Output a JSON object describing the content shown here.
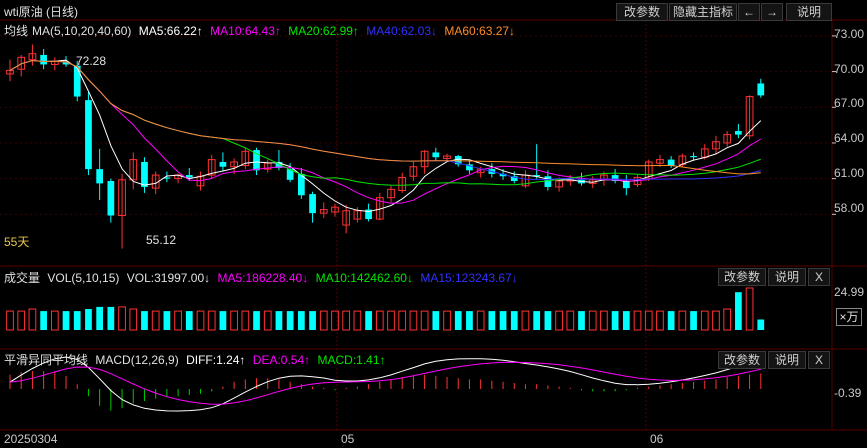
{
  "title": "wti原油 (日线)",
  "toolbar": {
    "edit_params": "改参数",
    "hide_indicators": "隐藏主指标",
    "left_arrow": "←",
    "right_arrow": "→",
    "help": "说明"
  },
  "main_indicator": {
    "name": "均线",
    "params": "MA(5,10,20,40,60)",
    "ma5": "MA5:66.22↑",
    "ma10": "MA10:64.43↑",
    "ma20": "MA20:62.99↑",
    "ma40": "MA40:62.03↓",
    "ma60": "MA60:63.27↓",
    "high_label": "72.28",
    "low_label": "55.12",
    "period_label": "55天",
    "y_ticks": [
      "73.00",
      "70.00",
      "67.00",
      "64.00",
      "61.00",
      "58.00"
    ]
  },
  "volume_panel": {
    "name": "成交量",
    "params": "VOL(5,10,15)",
    "vol": "VOL:31997.00↓",
    "ma5": "MA5:186228.40↓",
    "ma10": "MA10:142462.60↓",
    "ma15": "MA15:123243.67↓",
    "edit_params": "改参数",
    "help": "说明",
    "close": "X",
    "y_tick": "24.99",
    "unit": "×万"
  },
  "macd_panel": {
    "name": "平滑异同平均线",
    "params": "MACD(12,26,9)",
    "diff": "DIFF:1.24↑",
    "dea": "DEA:0.54↑",
    "macd": "MACD:1.41↑",
    "edit_params": "改参数",
    "help": "说明",
    "close": "X",
    "y_tick": "-0.39"
  },
  "x_axis": {
    "start": "20250304",
    "month5": "05",
    "month6": "06"
  },
  "colors": {
    "up": "#ff3232",
    "down": "#00ffff",
    "ma5": "#ffffff",
    "ma10": "#ff00ff",
    "ma20": "#00e600",
    "ma40": "#3030ff",
    "ma60": "#ff8c28",
    "macd_down": "#00c800",
    "grid": "#5a0000"
  },
  "chart_data": {
    "type": "candlestick",
    "y_range": [
      55.0,
      74.0
    ],
    "candles": [
      {
        "o": 69.8,
        "h": 71.0,
        "l": 69.2,
        "c": 70.1
      },
      {
        "o": 70.2,
        "h": 71.4,
        "l": 69.6,
        "c": 71.2
      },
      {
        "o": 71.0,
        "h": 72.28,
        "l": 70.5,
        "c": 71.5
      },
      {
        "o": 71.4,
        "h": 71.9,
        "l": 70.2,
        "c": 70.6
      },
      {
        "o": 70.6,
        "h": 71.2,
        "l": 70.1,
        "c": 70.9
      },
      {
        "o": 70.8,
        "h": 71.3,
        "l": 70.4,
        "c": 70.6
      },
      {
        "o": 70.5,
        "h": 70.9,
        "l": 67.5,
        "c": 67.9
      },
      {
        "o": 67.6,
        "h": 68.3,
        "l": 61.3,
        "c": 61.8
      },
      {
        "o": 61.8,
        "h": 63.5,
        "l": 59.2,
        "c": 60.6
      },
      {
        "o": 60.8,
        "h": 61.0,
        "l": 57.3,
        "c": 57.9
      },
      {
        "o": 57.9,
        "h": 61.4,
        "l": 55.12,
        "c": 60.9
      },
      {
        "o": 60.9,
        "h": 63.2,
        "l": 60.1,
        "c": 62.6
      },
      {
        "o": 62.4,
        "h": 62.8,
        "l": 59.8,
        "c": 60.3
      },
      {
        "o": 60.2,
        "h": 61.6,
        "l": 59.7,
        "c": 61.3
      },
      {
        "o": 61.1,
        "h": 61.6,
        "l": 60.7,
        "c": 61.0
      },
      {
        "o": 61.0,
        "h": 61.4,
        "l": 60.6,
        "c": 61.3
      },
      {
        "o": 61.3,
        "h": 61.9,
        "l": 60.8,
        "c": 61.1
      },
      {
        "o": 60.4,
        "h": 61.6,
        "l": 60.0,
        "c": 61.2
      },
      {
        "o": 61.3,
        "h": 63.0,
        "l": 61.0,
        "c": 62.6
      },
      {
        "o": 62.4,
        "h": 63.2,
        "l": 61.6,
        "c": 62.0
      },
      {
        "o": 62.0,
        "h": 62.7,
        "l": 61.4,
        "c": 62.4
      },
      {
        "o": 62.1,
        "h": 63.6,
        "l": 61.8,
        "c": 63.3
      },
      {
        "o": 63.4,
        "h": 63.6,
        "l": 61.3,
        "c": 61.7
      },
      {
        "o": 61.8,
        "h": 62.6,
        "l": 61.5,
        "c": 62.3
      },
      {
        "o": 62.4,
        "h": 63.4,
        "l": 61.7,
        "c": 61.9
      },
      {
        "o": 61.8,
        "h": 62.3,
        "l": 60.7,
        "c": 60.9
      },
      {
        "o": 61.4,
        "h": 61.9,
        "l": 59.3,
        "c": 59.6
      },
      {
        "o": 59.7,
        "h": 59.9,
        "l": 57.3,
        "c": 58.1
      },
      {
        "o": 58.1,
        "h": 59.0,
        "l": 57.7,
        "c": 58.4
      },
      {
        "o": 58.2,
        "h": 58.9,
        "l": 57.8,
        "c": 58.6
      },
      {
        "o": 57.1,
        "h": 58.8,
        "l": 56.4,
        "c": 58.3
      },
      {
        "o": 57.6,
        "h": 58.6,
        "l": 57.3,
        "c": 58.3
      },
      {
        "o": 58.4,
        "h": 58.9,
        "l": 57.4,
        "c": 57.6
      },
      {
        "o": 57.6,
        "h": 59.8,
        "l": 57.5,
        "c": 59.4
      },
      {
        "o": 59.4,
        "h": 60.4,
        "l": 59.0,
        "c": 60.1
      },
      {
        "o": 60.0,
        "h": 61.5,
        "l": 59.8,
        "c": 61.1
      },
      {
        "o": 61.2,
        "h": 62.4,
        "l": 60.8,
        "c": 62.0
      },
      {
        "o": 62.0,
        "h": 63.4,
        "l": 61.4,
        "c": 63.3
      },
      {
        "o": 63.2,
        "h": 63.6,
        "l": 62.5,
        "c": 62.8
      },
      {
        "o": 62.7,
        "h": 63.1,
        "l": 62.4,
        "c": 62.9
      },
      {
        "o": 62.9,
        "h": 63.0,
        "l": 62.0,
        "c": 62.2
      },
      {
        "o": 62.2,
        "h": 62.5,
        "l": 61.4,
        "c": 61.7
      },
      {
        "o": 61.5,
        "h": 62.0,
        "l": 61.1,
        "c": 61.8
      },
      {
        "o": 61.8,
        "h": 62.3,
        "l": 61.1,
        "c": 61.4
      },
      {
        "o": 61.4,
        "h": 61.8,
        "l": 60.9,
        "c": 61.2
      },
      {
        "o": 61.2,
        "h": 61.6,
        "l": 60.6,
        "c": 60.8
      },
      {
        "o": 60.4,
        "h": 61.7,
        "l": 60.2,
        "c": 61.3
      },
      {
        "o": 61.3,
        "h": 63.9,
        "l": 61.0,
        "c": 61.2
      },
      {
        "o": 61.2,
        "h": 61.7,
        "l": 60.0,
        "c": 60.3
      },
      {
        "o": 60.3,
        "h": 61.1,
        "l": 59.9,
        "c": 60.8
      },
      {
        "o": 60.8,
        "h": 61.3,
        "l": 60.4,
        "c": 60.9
      },
      {
        "o": 60.9,
        "h": 61.5,
        "l": 60.4,
        "c": 60.6
      },
      {
        "o": 60.6,
        "h": 61.2,
        "l": 60.2,
        "c": 60.9
      },
      {
        "o": 60.9,
        "h": 61.6,
        "l": 60.4,
        "c": 61.3
      },
      {
        "o": 61.3,
        "h": 61.8,
        "l": 60.6,
        "c": 60.8
      },
      {
        "o": 60.8,
        "h": 61.3,
        "l": 59.6,
        "c": 60.2
      },
      {
        "o": 60.5,
        "h": 61.3,
        "l": 60.3,
        "c": 61.1
      },
      {
        "o": 61.0,
        "h": 62.6,
        "l": 60.8,
        "c": 62.4
      },
      {
        "o": 62.3,
        "h": 63.0,
        "l": 62.0,
        "c": 62.6
      },
      {
        "o": 62.6,
        "h": 62.9,
        "l": 61.9,
        "c": 62.1
      },
      {
        "o": 62.2,
        "h": 63.1,
        "l": 62.0,
        "c": 62.9
      },
      {
        "o": 62.9,
        "h": 63.2,
        "l": 62.5,
        "c": 62.8
      },
      {
        "o": 62.8,
        "h": 63.9,
        "l": 62.6,
        "c": 63.5
      },
      {
        "o": 63.5,
        "h": 64.6,
        "l": 63.1,
        "c": 64.1
      },
      {
        "o": 64.0,
        "h": 65.0,
        "l": 63.7,
        "c": 64.7
      },
      {
        "o": 65.0,
        "h": 65.6,
        "l": 64.4,
        "c": 64.7
      },
      {
        "o": 64.6,
        "h": 68.0,
        "l": 64.3,
        "c": 67.9
      },
      {
        "o": 69.0,
        "h": 69.4,
        "l": 67.8,
        "c": 68.0
      }
    ],
    "volume": [
      0.45,
      0.45,
      0.5,
      0.45,
      0.45,
      0.45,
      0.45,
      0.5,
      0.55,
      0.55,
      0.55,
      0.5,
      0.45,
      0.45,
      0.45,
      0.45,
      0.45,
      0.45,
      0.45,
      0.45,
      0.45,
      0.45,
      0.45,
      0.45,
      0.45,
      0.45,
      0.45,
      0.45,
      0.45,
      0.45,
      0.45,
      0.45,
      0.45,
      0.45,
      0.45,
      0.45,
      0.45,
      0.45,
      0.45,
      0.45,
      0.45,
      0.45,
      0.45,
      0.45,
      0.45,
      0.45,
      0.45,
      0.45,
      0.45,
      0.45,
      0.45,
      0.45,
      0.45,
      0.45,
      0.45,
      0.45,
      0.45,
      0.45,
      0.45,
      0.45,
      0.45,
      0.45,
      0.45,
      0.45,
      0.5,
      0.9,
      1.0,
      0.25
    ],
    "macd_hist": [
      0.6,
      0.7,
      0.75,
      0.75,
      0.7,
      0.55,
      0.2,
      -0.3,
      -0.7,
      -0.9,
      -0.8,
      -0.6,
      -0.5,
      -0.4,
      -0.35,
      -0.3,
      -0.25,
      -0.2,
      -0.1,
      0.1,
      0.3,
      0.4,
      0.45,
      0.45,
      0.4,
      0.3,
      0.2,
      0.1,
      0.05,
      -0.05,
      0.05,
      0.1,
      0.2,
      0.3,
      0.4,
      0.5,
      0.55,
      0.6,
      0.55,
      0.5,
      0.45,
      0.4,
      0.4,
      0.35,
      0.3,
      0.25,
      0.2,
      0.2,
      0.15,
      0.1,
      0.05,
      -0.05,
      -0.1,
      -0.1,
      -0.1,
      -0.05,
      0.05,
      0.1,
      0.15,
      0.2,
      0.25,
      0.3,
      0.35,
      0.4,
      0.5,
      0.55,
      0.6,
      0.65
    ]
  }
}
